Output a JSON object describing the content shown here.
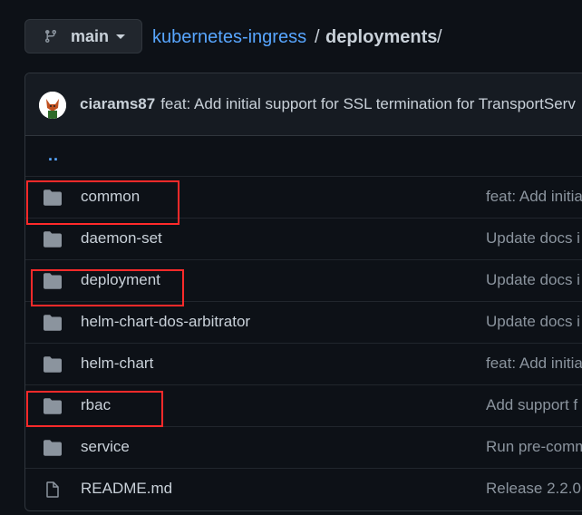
{
  "branch": {
    "label": "main"
  },
  "breadcrumb": {
    "repo": "kubernetes-ingress",
    "sep": "/",
    "dir": "deployments",
    "trail": "/"
  },
  "latest_commit": {
    "author": "ciarams87",
    "message": "feat: Add initial support for SSL termination for TransportServ"
  },
  "updir": "..",
  "files": [
    {
      "name": "common",
      "type": "folder",
      "message": "feat: Add initia"
    },
    {
      "name": "daemon-set",
      "type": "folder",
      "message": "Update docs i"
    },
    {
      "name": "deployment",
      "type": "folder",
      "message": "Update docs i"
    },
    {
      "name": "helm-chart-dos-arbitrator",
      "type": "folder",
      "message": "Update docs i"
    },
    {
      "name": "helm-chart",
      "type": "folder",
      "message": "feat: Add initia"
    },
    {
      "name": "rbac",
      "type": "folder",
      "message": "Add support f"
    },
    {
      "name": "service",
      "type": "folder",
      "message": "Run pre-comm"
    },
    {
      "name": "README.md",
      "type": "file",
      "message": "Release 2.2.0 ("
    }
  ],
  "colors": {
    "highlight": "#ff2a2a",
    "link": "#58a6ff",
    "folder": "#8b949e"
  }
}
